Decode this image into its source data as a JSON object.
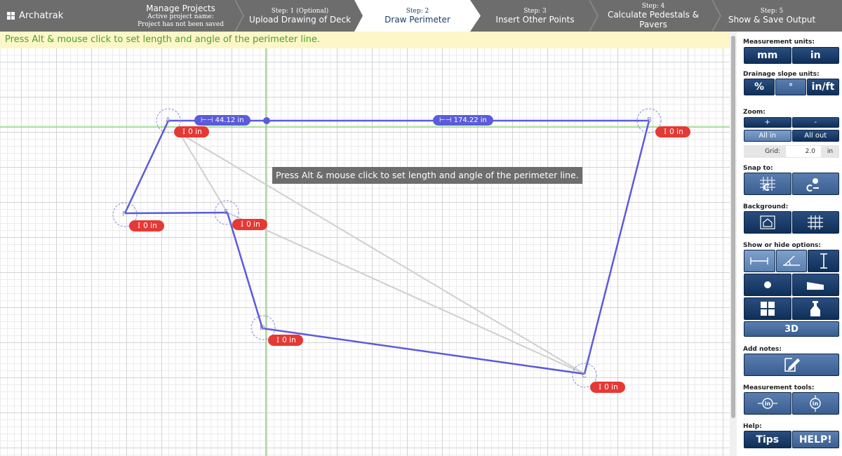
{
  "app": {
    "logo_text": "Archatrak"
  },
  "steps": {
    "manage": {
      "title": "Manage Projects",
      "sub1": "Active project name:",
      "sub2": "Project has not been saved"
    },
    "step1": {
      "kicker": "Step: 1 (Optional)",
      "title": "Upload Drawing of Deck"
    },
    "step2": {
      "kicker": "Step: 2",
      "title": "Draw Perimeter"
    },
    "step3": {
      "kicker": "Step: 3",
      "title": "Insert Other Points"
    },
    "step4": {
      "kicker": "Step: 4",
      "title": "Calculate Pedestals & Pavers"
    },
    "step5": {
      "kicker": "Step: 5",
      "title": "Show & Save Output"
    }
  },
  "canvas": {
    "hint": "Press Alt & mouse click to set length and angle of the perimeter line.",
    "center_message": "Press Alt & mouse click to set length and angle of the perimeter line.",
    "segment_lengths": [
      "44.12 in",
      "174.22 in"
    ],
    "points": [
      {
        "id": "A",
        "height": "0 in"
      },
      {
        "id": "B",
        "height": "0 in"
      },
      {
        "id": "C",
        "height": "0 in"
      },
      {
        "id": "D",
        "height": "0 in"
      },
      {
        "id": "E",
        "height": "0 in"
      },
      {
        "id": "F",
        "height": "0 in"
      }
    ]
  },
  "panel": {
    "measurement_units": {
      "label": "Measurement units:",
      "options": [
        "mm",
        "in"
      ],
      "selected": "in"
    },
    "drainage_units": {
      "label": "Drainage slope units:",
      "options": [
        "%",
        "°",
        "in/ft"
      ]
    },
    "zoom": {
      "label": "Zoom:",
      "plus": "+",
      "minus": "-",
      "all_in": "All in",
      "all_out": "All out"
    },
    "grid": {
      "label": "Grid:",
      "value": "2.0",
      "unit": "in"
    },
    "snap": {
      "label": "Snap to:"
    },
    "background": {
      "label": "Background:"
    },
    "show_hide": {
      "label": "Show or hide options:",
      "three_d": "3D"
    },
    "notes": {
      "label": "Add notes:"
    },
    "measure_tools": {
      "label": "Measurement tools:"
    },
    "help": {
      "label": "Help:",
      "tips": "Tips",
      "help": "HELP!"
    }
  },
  "colors": {
    "perimeter": "#5b5bdb",
    "badge": "#e53935",
    "axis": "#86d07a",
    "panel_button": "#1f4272",
    "hint_text": "#4aa02c"
  }
}
